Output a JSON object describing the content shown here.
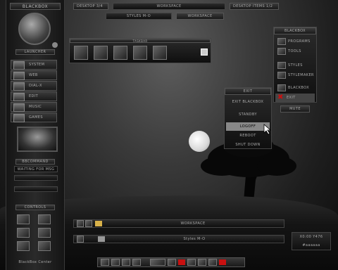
{
  "left_panel": {
    "title": "BLACKBOX",
    "section_launcher": "LAUNCHER",
    "items": [
      {
        "label": "SYSTEM",
        "icon": "system-icon"
      },
      {
        "label": "WEB",
        "icon": "web-icon"
      },
      {
        "label": "DIAL-X",
        "icon": "dialx-icon"
      },
      {
        "label": "EDIT",
        "icon": "edit-icon"
      },
      {
        "label": "MUSIC",
        "icon": "music-icon"
      },
      {
        "label": "GAMES",
        "icon": "games-icon"
      }
    ],
    "section_bbcommand": "BBCOMMAND",
    "status": "WAITING FOR MSG",
    "section_controls": "CONTROLS",
    "footer": "BlackBox Center"
  },
  "top_bar": {
    "desktop_label": "DESKTOP 3/4",
    "workspace_label": "WORKSPACE",
    "right_label": "DESKTOP  ITEMS 1/2",
    "styles_label": "STYLES M-O",
    "workspace2_label": "WORKSPACE"
  },
  "toolbar": {
    "title": "TASKBAR"
  },
  "menu": {
    "title": "BLACKBOX",
    "items": [
      "PROGRAMS",
      "TOOLS",
      "STYLES",
      "STYLEMAKER",
      "BLACKBOX",
      "EXIT"
    ],
    "mute": "MUTE"
  },
  "exit_menu": {
    "title": "EXIT",
    "items": [
      "EXIT BLACKBOX",
      "STANDBY",
      "LOGOFF",
      "REBOOT",
      "SHUT DOWN"
    ],
    "selected": "LOGOFF"
  },
  "bottom_bar": {
    "workspace": "WORKSPACE",
    "styles": "Styles M-O",
    "clock_time": "X0:00 Y476",
    "clock_color": "#aaaaaa"
  },
  "colors": {
    "accent": "#c81010",
    "panel": "#1a1a1a"
  }
}
